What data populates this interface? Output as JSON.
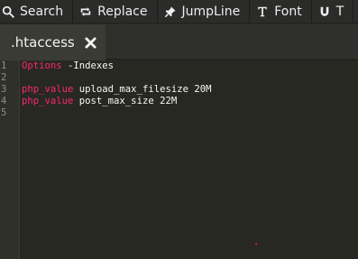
{
  "toolbar": {
    "buttons": [
      {
        "label": "Search",
        "icon": "search-icon"
      },
      {
        "label": "Replace",
        "icon": "replace-icon"
      },
      {
        "label": "JumpLine",
        "icon": "pin-icon"
      },
      {
        "label": "Font",
        "icon": "font-icon"
      },
      {
        "label": "T",
        "icon": "magnet-icon"
      }
    ]
  },
  "tab": {
    "title": ".htaccess",
    "close_icon": "close-icon"
  },
  "editor": {
    "line_numbers": [
      "1",
      "2",
      "3",
      "4",
      "5"
    ],
    "lines": [
      {
        "key": "Options",
        "value": " -Indexes"
      },
      {
        "key": "",
        "value": ""
      },
      {
        "key": "php_value",
        "value": " upload_max_filesize 20M"
      },
      {
        "key": "php_value",
        "value": " post_max_size 22M"
      },
      {
        "key": "",
        "value": ""
      }
    ]
  },
  "colors": {
    "background": "#272822",
    "toolbar": "#2b2c2a",
    "tab_active": "#3a3b35",
    "keyword": "#f92672",
    "text": "#f8f8f2",
    "line_number": "#8f908a"
  }
}
